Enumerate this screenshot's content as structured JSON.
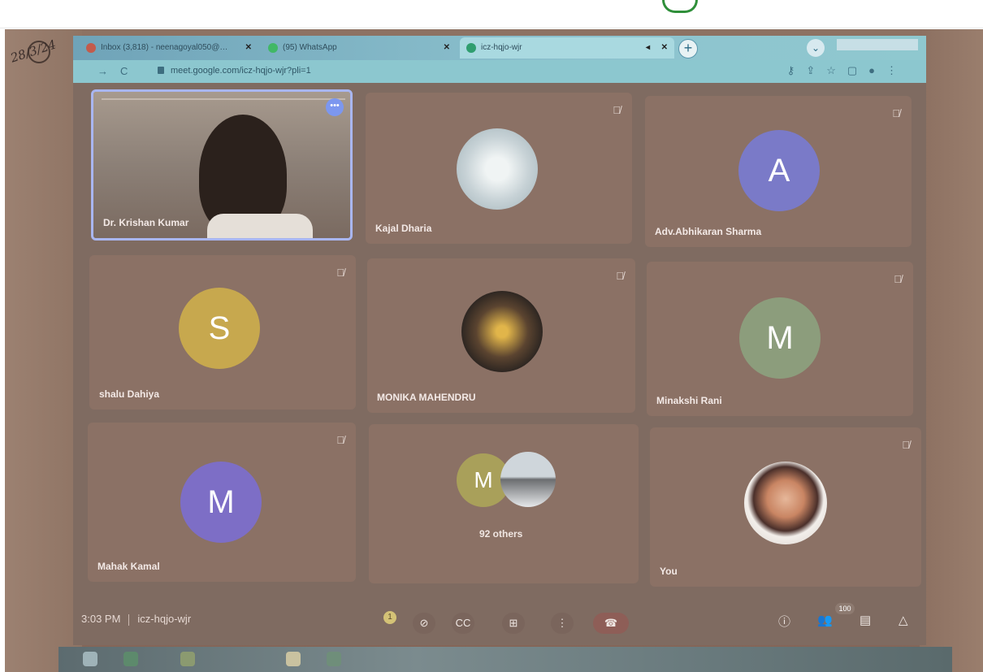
{
  "overlay": {
    "scribble": "28/3/24"
  },
  "browser": {
    "tabs": [
      {
        "label": "Inbox (3,818) - neenagoyal050@…",
        "icon": "gmail-icon",
        "color": "#c35b4b"
      },
      {
        "label": "(95) WhatsApp",
        "icon": "whatsapp-icon",
        "color": "#41b866"
      },
      {
        "label": "icz-hqjo-wjr",
        "icon": "meet-icon",
        "color": "#2f9e6f"
      }
    ],
    "new_tab_label": "+",
    "url": "meet.google.com/icz-hqjo-wjr?pli=1"
  },
  "participants": [
    {
      "name": "Dr. Krishan Kumar",
      "type": "video",
      "muted": false
    },
    {
      "name": "Kajal Dharia",
      "type": "photo",
      "muted": true
    },
    {
      "name": "Adv.Abhikaran Sharma",
      "type": "initial",
      "initial": "A",
      "color": "#7a7ac8",
      "muted": true
    },
    {
      "name": "shalu Dahiya",
      "type": "initial",
      "initial": "S",
      "color": "#c7a84e",
      "muted": true
    },
    {
      "name": "MONIKA MAHENDRU",
      "type": "photo",
      "muted": true
    },
    {
      "name": "Minakshi Rani",
      "type": "initial",
      "initial": "M",
      "color": "#8c9d7c",
      "muted": true
    },
    {
      "name": "Mahak Kamal",
      "type": "initial",
      "initial": "M",
      "color": "#7d6ec6",
      "muted": true
    },
    {
      "name": "92 others",
      "type": "group",
      "initial": "M",
      "color": "#a9a05a",
      "muted": false
    },
    {
      "name": "You",
      "type": "photo",
      "muted": true
    }
  ],
  "bottom": {
    "time": "3:03 PM",
    "meeting_code": "icz-hqjo-wjr",
    "raised_hands": "1",
    "participant_count": "100"
  }
}
